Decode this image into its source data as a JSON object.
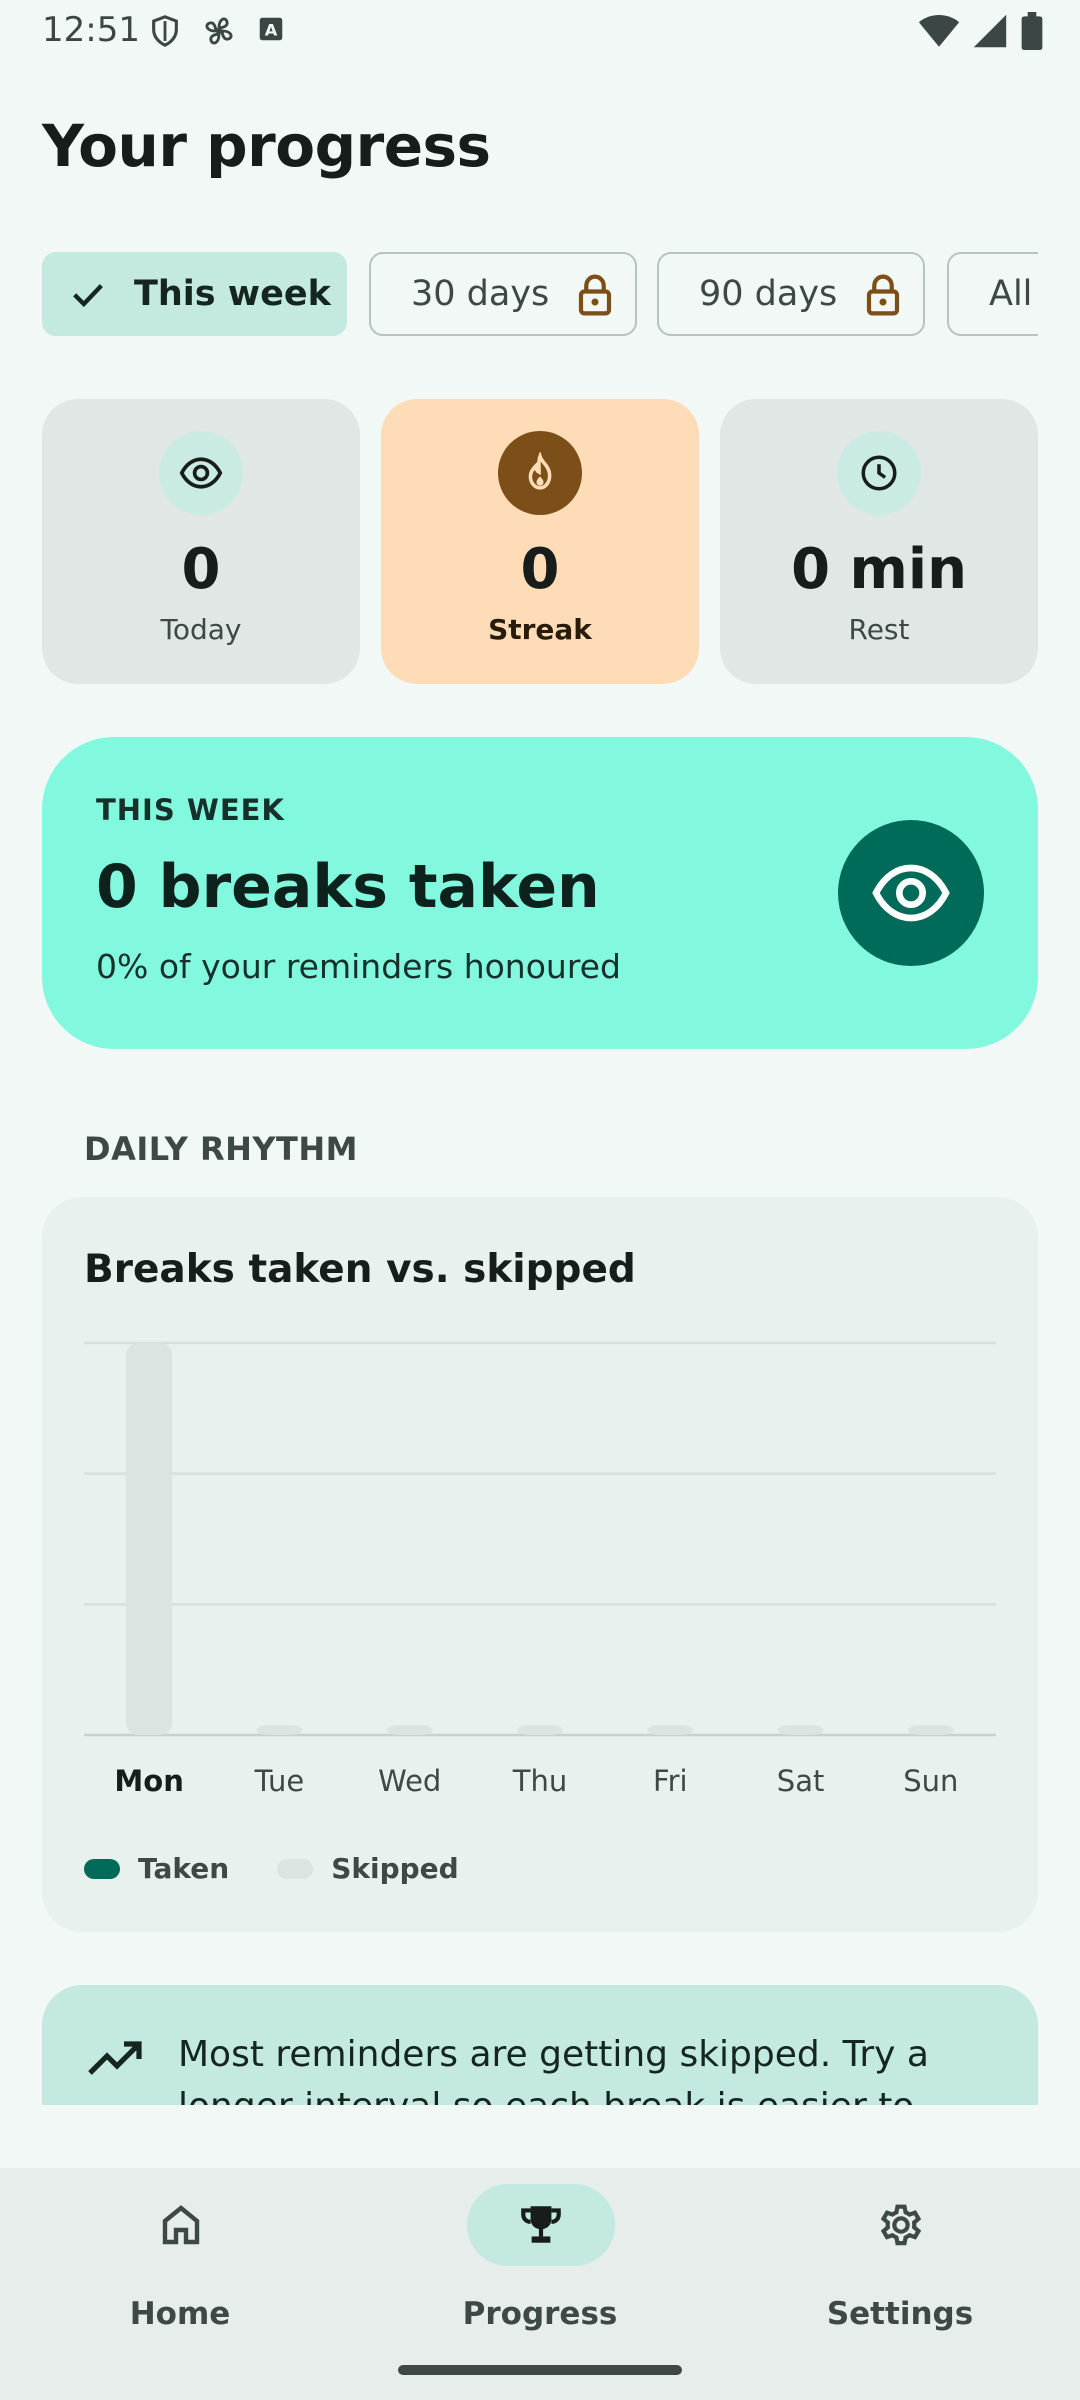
{
  "status_bar": {
    "time": "12:51",
    "left_icons": [
      "shield-icon",
      "fan-icon",
      "keyboard-a-icon"
    ],
    "right_icons": [
      "wifi-icon",
      "signal-icon",
      "battery-icon"
    ]
  },
  "page_title": "Your progress",
  "filters": [
    {
      "label": "This week",
      "selected": true,
      "locked": false
    },
    {
      "label": "30 days",
      "selected": false,
      "locked": true
    },
    {
      "label": "90 days",
      "selected": false,
      "locked": true
    },
    {
      "label": "All",
      "selected": false,
      "locked": false
    }
  ],
  "stats": [
    {
      "icon": "eye-icon",
      "value": "0",
      "label": "Today"
    },
    {
      "icon": "flame-icon",
      "value": "0",
      "label": "Streak"
    },
    {
      "icon": "clock-icon",
      "value": "0 min",
      "label": "Rest"
    }
  ],
  "summary": {
    "eyebrow": "THIS WEEK",
    "title": "0 breaks taken",
    "subtitle": "0% of your reminders honoured",
    "icon": "eye-icon"
  },
  "section_label": "DAILY RHYTHM",
  "chart_title": "Breaks taken vs. skipped",
  "chart_data": {
    "type": "bar",
    "title": "Breaks taken vs. skipped",
    "categories": [
      "Mon",
      "Tue",
      "Wed",
      "Thu",
      "Fri",
      "Sat",
      "Sun"
    ],
    "series": [
      {
        "name": "Taken",
        "values": [
          0,
          0,
          0,
          0,
          0,
          0,
          0
        ],
        "color": "#006b58"
      },
      {
        "name": "Skipped",
        "values": [
          3,
          0,
          0,
          0,
          0,
          0,
          0
        ],
        "color": "#dbe4e1"
      }
    ],
    "stacked": true,
    "ylim": [
      0,
      3
    ],
    "grid": true,
    "legend": "bottom-left",
    "highlight_category": "Mon"
  },
  "legend": {
    "taken": "Taken",
    "skipped": "Skipped"
  },
  "tip": {
    "icon": "trending-up-icon",
    "text": "Most reminders are getting skipped. Try a longer interval so each break is easier to"
  },
  "nav": [
    {
      "label": "Home",
      "icon": "home-icon",
      "active": false
    },
    {
      "label": "Progress",
      "icon": "trophy-icon",
      "active": true
    },
    {
      "label": "Settings",
      "icon": "gear-icon",
      "active": false
    }
  ],
  "colors": {
    "background": "#f1f8f5",
    "accent": "#006b58",
    "summary_bg": "#82f8df",
    "streak_bg": "#ffdcb8",
    "chip_selected": "#c3e9e0"
  }
}
